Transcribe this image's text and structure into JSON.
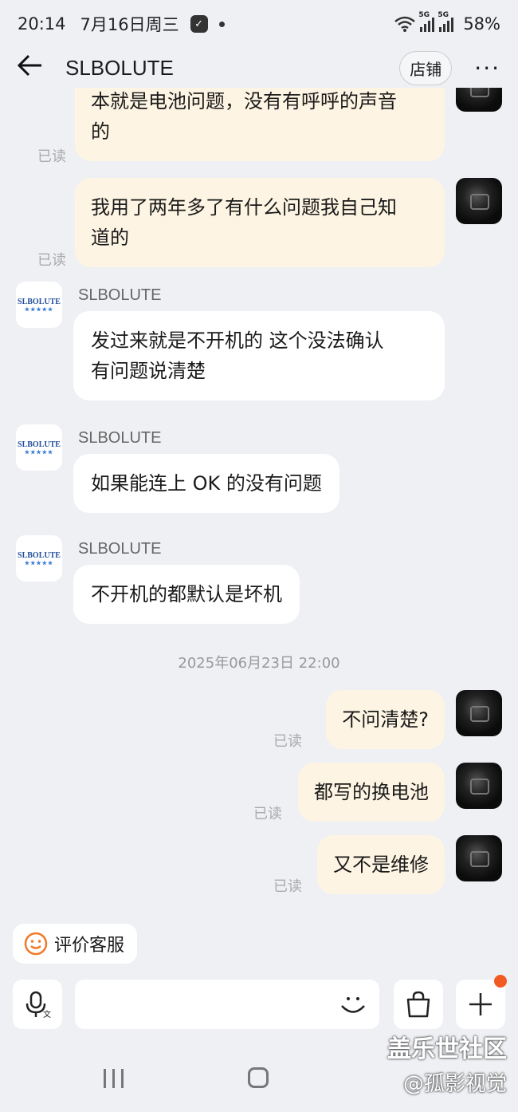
{
  "status_bar": {
    "time": "20:14",
    "date": "7月16日周三",
    "app_badge": "✓",
    "network_1": "5G",
    "network_2": "5G",
    "battery": "58%"
  },
  "header": {
    "title": "SLBOLUTE",
    "shop_label": "店铺",
    "more_label": "···"
  },
  "messages": [
    {
      "dir": "out",
      "text_line1": "本就是电池问题，没有有呼呼的声音",
      "text_line2": "的",
      "read": "已读"
    },
    {
      "dir": "out",
      "text_line1": "我用了两年多了有什么问题我自己知",
      "text_line2": "道的",
      "read": "已读"
    },
    {
      "dir": "in",
      "sender": "SLBOLUTE",
      "text_line1": "发过来就是不开机的  这个没法确认",
      "text_line2": "有问题说清楚"
    },
    {
      "dir": "in",
      "sender": "SLBOLUTE",
      "text": "如果能连上  OK  的没有问题"
    },
    {
      "dir": "in",
      "sender": "SLBOLUTE",
      "text": "不开机的都默认是坏机"
    },
    {
      "dir": "out",
      "text": "不问清楚?",
      "read": "已读"
    },
    {
      "dir": "out",
      "text": "都写的换电池",
      "read": "已读"
    },
    {
      "dir": "out",
      "text": "又不是维修",
      "read": "已读"
    }
  ],
  "timestamp": "2025年06月23日 22:00",
  "shop_avatar": {
    "text": "SLBOLUTE",
    "stars": "★★★★★"
  },
  "bottom": {
    "eval_label": "评价客服",
    "input_placeholder": "",
    "voice_sub": "文"
  },
  "watermark": {
    "line1": "盖乐世社区",
    "line2": "@孤影视觉"
  },
  "colors": {
    "background": "#eef0f4",
    "outgoing_bubble": "#fdf4e3",
    "incoming_bubble": "#ffffff",
    "accent_orange": "#f25a22"
  }
}
